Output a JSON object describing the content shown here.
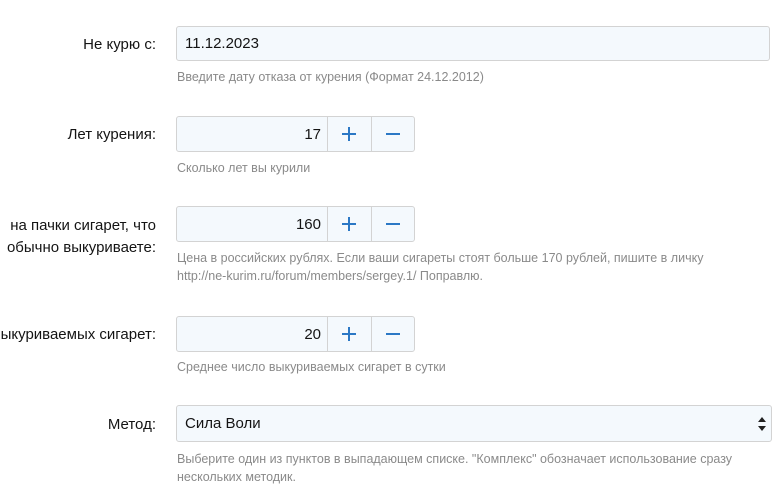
{
  "fields": {
    "quit_date": {
      "label": "Не курю с:",
      "value": "11.12.2023",
      "hint": "Введите дату отказа от курения (Формат 24.12.2012)"
    },
    "years_smoking": {
      "label": "Лет курения:",
      "value": "17",
      "hint": "Сколько лет вы курили"
    },
    "pack_price": {
      "label_line1": "на пачки сигарет, что",
      "label_line2": "обычно выкуриваете:",
      "value": "160",
      "hint_line1": "Цена в российских рублях. Если ваши сигареты стоят больше 170 рублей, пишите в личку",
      "hint_line2": "http://ne-kurim.ru/forum/members/sergey.1/ Поправлю."
    },
    "cigarettes_per_day": {
      "label": "ыкуриваемых сигарет:",
      "value": "20",
      "hint": "Среднее число выкуриваемых сигарет в сутки"
    },
    "method": {
      "label": "Метод:",
      "selected": "Сила Воли",
      "hint_line1": "Выберите один из пунктов в выпадающем списке. \"Комплекс\" обозначает использование сразу",
      "hint_line2": "нескольких методик."
    }
  },
  "buttons": {
    "plus_glyph": "plus-icon",
    "minus_glyph": "minus-icon"
  },
  "colors": {
    "accent": "#2b78c5",
    "input_bg": "#f4f9fd",
    "border": "#d3d3d3",
    "hint": "#8a8a8a"
  }
}
